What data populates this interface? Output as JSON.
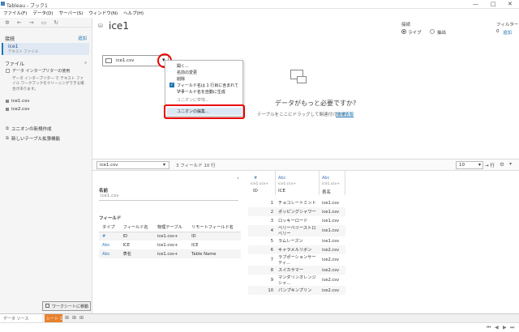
{
  "window": {
    "title": "Tableau - ブック1",
    "controls": {
      "minimize": "—",
      "maximize": "□",
      "close": "✕"
    }
  },
  "menubar": [
    "ファイル(F)",
    "データ(D)",
    "サーバー(S)",
    "ウィンドウ(N)",
    "ヘルプ(H)"
  ],
  "left_panel": {
    "connections_label": "接続",
    "add_link": "追加",
    "connection_name": "ice1",
    "connection_type": "テキスト ファイル",
    "files_label": "ファイル",
    "interpreter_option": "データ インタープリターの使用",
    "interpreter_desc": "データ インタープリター で テキスト ファイル ワークブックをクリーニングできる場合があります。",
    "files": [
      "ice1.csv",
      "ice2.csv"
    ],
    "new_union": "ユニオンの新規作成",
    "new_table_ext": "新しいテーブル拡張機能"
  },
  "canvas": {
    "title": "ice1",
    "connection_label": "接続",
    "live_label": "ライブ",
    "extract_label": "抽出",
    "filter_label": "フィルター",
    "filter_count": "0",
    "filter_add": "追加",
    "table_pill": "ice1.csv",
    "need_more": "データがもっと必要ですか?",
    "need_more_sub": "テーブルをここにドラッグして関連付けます。",
    "learn_more": "詳細情報"
  },
  "context_menu": {
    "items": [
      "開く...",
      "名前の変更",
      "削除",
      "フィールド名は 1 行目に含まれている",
      "フィールド名を自動に生成",
      "ユニオンに変換...",
      "ユニオンの編集..."
    ],
    "checked_item": "フィールド名は 1 行目に含まれている"
  },
  "grid_bar": {
    "table_select": "ice1.csv",
    "fields_info": "3 フィールド 10 行",
    "rows_value": "10",
    "rows_arrow": "→ 行"
  },
  "meta": {
    "name_label": "名前",
    "name_value": "ice1.csv",
    "fields_label": "フィールド",
    "columns": [
      "タイプ",
      "フィールド名",
      "物理テーブル",
      "リモートフィールド名"
    ],
    "rows": [
      {
        "type": "#",
        "field": "ID",
        "table": "ice1.csv+",
        "remote": "ID"
      },
      {
        "type": "Abc",
        "field": "ICE",
        "table": "ice1.csv+",
        "remote": "ICE"
      },
      {
        "type": "Abc",
        "field": "表名",
        "table": "ice1.csv+",
        "remote": "Table Name"
      }
    ]
  },
  "data_grid": {
    "headers": [
      {
        "type": "#",
        "source": "ice1.csv+",
        "name": "ID"
      },
      {
        "type": "Abc",
        "source": "ice1.csv+",
        "name": "ICE"
      },
      {
        "type": "Abc",
        "source": "ice1.csv+",
        "name": "表名"
      }
    ],
    "rows": [
      [
        "1",
        "チョコレートミント",
        "ice1.csv"
      ],
      [
        "2",
        "ポッピングシャワー",
        "ice1.csv"
      ],
      [
        "3",
        "ロッキーロード",
        "ice1.csv"
      ],
      [
        "4",
        "ベリーベリーストロベリー",
        "ice1.csv"
      ],
      [
        "5",
        "ラムレーズン",
        "ice1.csv"
      ],
      [
        "6",
        "キャラメルリボン",
        "ice2.csv"
      ],
      [
        "7",
        "ラブポーションサーティ...",
        "ice2.csv"
      ],
      [
        "8",
        "スイカサマー",
        "ice2.csv"
      ],
      [
        "9",
        "マンダリンオレンジシャ...",
        "ice2.csv"
      ],
      [
        "10",
        "パンプキンプリン",
        "ice2.csv"
      ]
    ]
  },
  "footer": {
    "go_to_sheet": "ワークシートに移動",
    "data_source_tab": "データ ソース",
    "sheet1_tab": "シート 1"
  }
}
